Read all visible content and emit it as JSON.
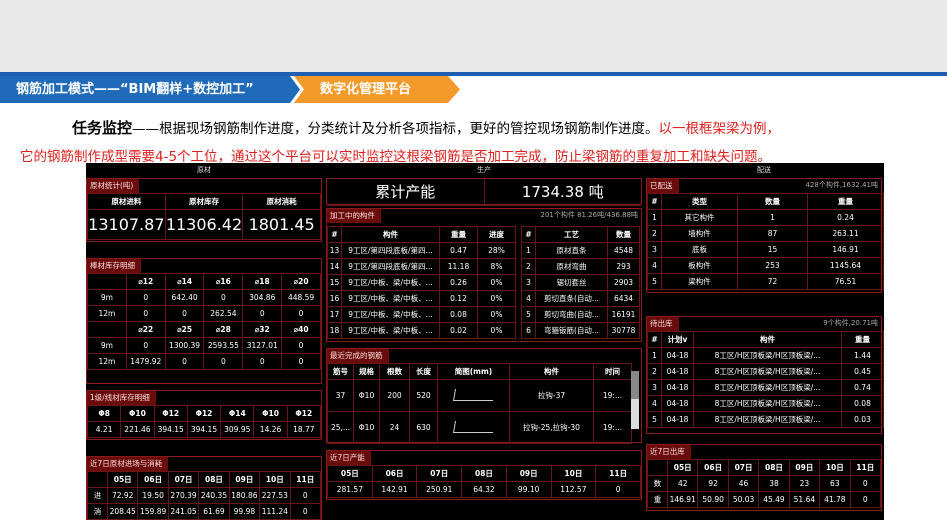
{
  "header": {
    "tab1": "钢筋加工模式——“BIM翻样+数控加工”",
    "tab2": "数字化管理平台"
  },
  "intro": {
    "title": "任务监控",
    "text": "——根据现场钢筋制作进度，分类统计及分析各项指标，更好的管控现场钢筋制作进度。",
    "red1": "以一根框架梁为例，",
    "red2": "它的钢筋制作成型需要4-5个工位，通过这个平台可以实时监控这根梁钢筋是否加工完成，防止梁钢筋的重复加工和缺失问题。"
  },
  "sections": {
    "raw": "原材",
    "prod": "生产",
    "dist": "配送"
  },
  "raw_stats": {
    "title": "原材统计(吨)",
    "headers": [
      "原材进料",
      "原材库存",
      "原材消耗"
    ],
    "values": [
      "13107.87",
      "11306.42",
      "1801.45"
    ]
  },
  "bar_stock": {
    "title": "棒材库存明细",
    "head1": [
      "",
      "⌀12",
      "⌀14",
      "⌀16",
      "⌀18",
      "⌀20"
    ],
    "rows1": [
      [
        "9m",
        "0",
        "642.40",
        "0",
        "304.86",
        "448.59"
      ],
      [
        "12m",
        "0",
        "0",
        "262.54",
        "0",
        "0"
      ]
    ],
    "head2": [
      "",
      "⌀22",
      "⌀25",
      "⌀28",
      "⌀32",
      "⌀40"
    ],
    "rows2": [
      [
        "9m",
        "0",
        "1300.39",
        "2593.55",
        "3127.01",
        "0"
      ],
      [
        "12m",
        "1479.92",
        "0",
        "0",
        "0",
        "0"
      ]
    ]
  },
  "coil_stock": {
    "title": "1级/线材库存明细",
    "head": [
      "Φ8",
      "Φ10",
      "Φ12",
      "Φ12",
      "Φ14",
      "Φ10",
      "Φ12"
    ],
    "row": [
      "4.21",
      "221.46",
      "394.15",
      "394.15",
      "309.95",
      "14.26",
      "18.77"
    ]
  },
  "raw_recent": {
    "title": "近7日原材进场与消耗",
    "head": [
      "",
      "05日",
      "06日",
      "07日",
      "08日",
      "09日",
      "10日",
      "11日"
    ],
    "rows": [
      [
        "进",
        "72.92",
        "19.50",
        "270.39",
        "240.35",
        "180.86",
        "227.53",
        "0"
      ],
      [
        "消",
        "208.45",
        "159.89",
        "241.05",
        "61.69",
        "99.98",
        "111.24",
        "0"
      ]
    ]
  },
  "production": {
    "label": "累计产能",
    "value": "1734.38 吨"
  },
  "processing": {
    "title": "加工中的构件",
    "note": "201个构件 81.26吨/436.88吨",
    "head": [
      "#",
      "构件",
      "重量",
      "进度"
    ],
    "rows": [
      [
        "13",
        "9工区/第四段底板/第四...",
        "0.47",
        "28%"
      ],
      [
        "14",
        "9工区/第四段底板/第四...",
        "11.18",
        "8%"
      ],
      [
        "15",
        "9工区/中板、梁/中板、...",
        "0.26",
        "0%"
      ],
      [
        "16",
        "9工区/中板、梁/中板、...",
        "0.12",
        "0%"
      ],
      [
        "17",
        "9工区/中板、梁/中板、...",
        "0.08",
        "0%"
      ],
      [
        "18",
        "9工区/中板、梁/中板、...",
        "0.02",
        "0%"
      ]
    ]
  },
  "craft": {
    "head": [
      "#",
      "工艺",
      "数量"
    ],
    "rows": [
      [
        "1",
        "原材直条",
        "4548"
      ],
      [
        "2",
        "原材弯曲",
        "293"
      ],
      [
        "3",
        "锯切套丝",
        "2903"
      ],
      [
        "4",
        "剪切直条(自动...",
        "6434"
      ],
      [
        "5",
        "剪切弯曲(自动...",
        "16191"
      ],
      [
        "6",
        "弯箍钣筋(自动...",
        "30778"
      ]
    ]
  },
  "completed": {
    "title": "最近完成的钢筋",
    "head": [
      "筋号",
      "规格",
      "根数",
      "长度",
      "简图(mm)",
      "构件",
      "时间"
    ],
    "rows": [
      [
        "37",
        "Φ10",
        "200",
        "520",
        "",
        "拉钩-37",
        "19:..."
      ],
      [
        "25,...",
        "Φ10",
        "24",
        "630",
        "",
        "拉钩-25,拉钩-30",
        "19:..."
      ]
    ]
  },
  "prod_recent": {
    "title": "近7日产能",
    "head": [
      "05日",
      "06日",
      "07日",
      "08日",
      "09日",
      "10日",
      "11日"
    ],
    "row": [
      "281.57",
      "142.91",
      "250.91",
      "64.32",
      "99.10",
      "112.57",
      "0"
    ]
  },
  "delivered": {
    "title": "已配送",
    "note": "428个构件,1632.41吨",
    "head": [
      "#",
      "类型",
      "数量",
      "重量"
    ],
    "rows": [
      [
        "1",
        "其它构件",
        "1",
        "0.24"
      ],
      [
        "2",
        "墙构件",
        "87",
        "263.11"
      ],
      [
        "3",
        "底板",
        "15",
        "146.91"
      ],
      [
        "4",
        "板构件",
        "253",
        "1145.64"
      ],
      [
        "5",
        "梁构件",
        "72",
        "76.51"
      ]
    ]
  },
  "pending": {
    "title": "待出库",
    "note": "9个构件,20.71吨",
    "head": [
      "#",
      "计划v",
      "构件",
      "重量"
    ],
    "rows": [
      [
        "1",
        "04-18",
        "8工区/H区顶板梁/H区顶板梁/...",
        "1.44"
      ],
      [
        "2",
        "04-18",
        "8工区/H区顶板梁/H区顶板梁/...",
        "0.45"
      ],
      [
        "3",
        "04-18",
        "8工区/H区顶板梁/H区顶板梁/...",
        "0.74"
      ],
      [
        "4",
        "04-18",
        "8工区/H区顶板梁/H区顶板梁/...",
        "0.08"
      ],
      [
        "5",
        "04-18",
        "8工区/H区顶板梁/H区顶板梁/...",
        "0.03"
      ]
    ]
  },
  "out_recent": {
    "title": "近7日出库",
    "head": [
      "",
      "05日",
      "06日",
      "07日",
      "08日",
      "09日",
      "10日",
      "11日"
    ],
    "rows": [
      [
        "数",
        "42",
        "92",
        "46",
        "38",
        "23",
        "63",
        "0"
      ],
      [
        "重",
        "146.91",
        "50.90",
        "50.03",
        "45.49",
        "51.64",
        "41.78",
        "0"
      ]
    ]
  },
  "colors": {
    "blue": "#1f6bb9",
    "orange": "#f39a2a",
    "red": "#e0201e",
    "panel_border": "#8a1a1a"
  }
}
